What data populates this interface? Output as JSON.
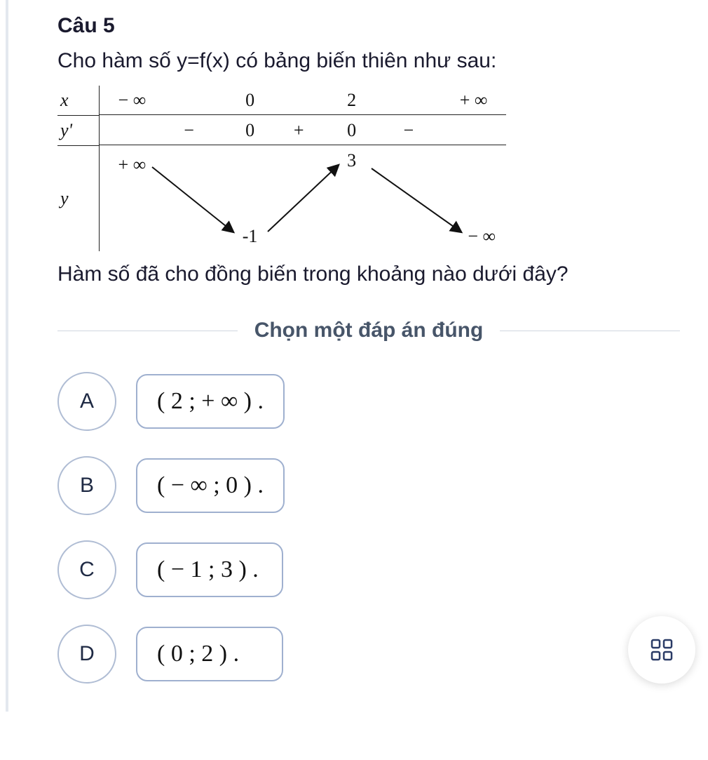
{
  "question": {
    "label": "Câu 5",
    "prompt": "Cho hàm số y=f(x) có bảng biến thiên như sau:",
    "subquestion": "Hàm số đã cho đồng biến trong khoảng nào dưới đây?"
  },
  "variation_table": {
    "row_labels": {
      "x": "x",
      "yprime": "y'",
      "y": "y"
    },
    "x_values": [
      "− ∞",
      "0",
      "2",
      "+ ∞"
    ],
    "yprime_row": [
      "−",
      "0",
      "+",
      "0",
      "−"
    ],
    "y_row": {
      "left_limit": "+ ∞",
      "local_min": "-1",
      "local_max": "3",
      "right_limit": "− ∞"
    }
  },
  "instruction": "Chọn một đáp án đúng",
  "options": [
    {
      "letter": "A",
      "text": "( 2 ; + ∞ ) ."
    },
    {
      "letter": "B",
      "text": "( − ∞ ; 0 ) ."
    },
    {
      "letter": "C",
      "text": "( − 1 ; 3 ) ."
    },
    {
      "letter": "D",
      "text": "( 0 ; 2 ) ."
    }
  ],
  "icons": {
    "grid": "grid-icon"
  }
}
